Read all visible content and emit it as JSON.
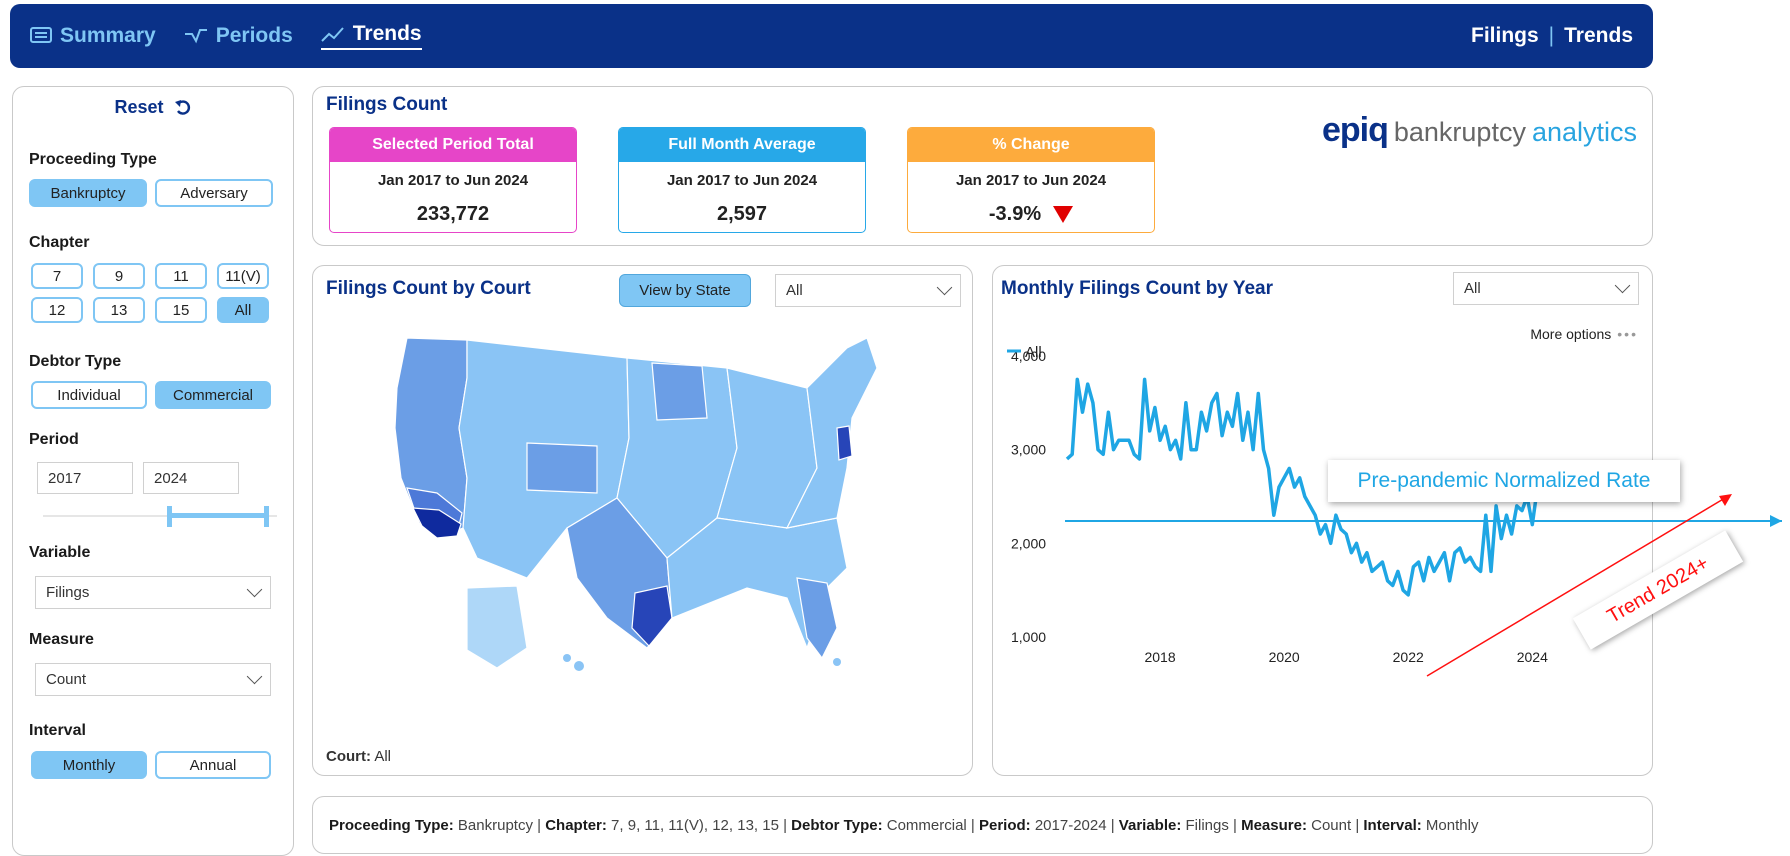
{
  "nav": {
    "tabs": [
      {
        "label": "Summary",
        "icon": "summary-icon"
      },
      {
        "label": "Periods",
        "icon": "periods-icon"
      },
      {
        "label": "Trends",
        "icon": "trends-icon"
      }
    ],
    "right_left": "Filings",
    "right_sep": "|",
    "right_right": "Trends"
  },
  "filters": {
    "reset_label": "Reset",
    "proceeding_type": {
      "label": "Proceeding Type",
      "options": [
        "Bankruptcy",
        "Adversary"
      ],
      "selected": "Bankruptcy"
    },
    "chapter": {
      "label": "Chapter",
      "options": [
        "7",
        "9",
        "11",
        "11(V)",
        "12",
        "13",
        "15",
        "All"
      ],
      "selected": "All"
    },
    "debtor_type": {
      "label": "Debtor Type",
      "options": [
        "Individual",
        "Commercial"
      ],
      "selected": "Commercial"
    },
    "period": {
      "label": "Period",
      "start": "2017",
      "end": "2024"
    },
    "variable": {
      "label": "Variable",
      "value": "Filings"
    },
    "measure": {
      "label": "Measure",
      "value": "Count"
    },
    "interval": {
      "label": "Interval",
      "options": [
        "Monthly",
        "Annual"
      ],
      "selected": "Monthly"
    }
  },
  "kpi": {
    "title": "Filings Count",
    "cards": [
      {
        "header": "Selected Period Total",
        "period": "Jan 2017 to Jun 2024",
        "value": "233,772",
        "color": "#e645c8"
      },
      {
        "header": "Full Month Average",
        "period": "Jan 2017 to Jun 2024",
        "value": "2,597",
        "color": "#27a8e8"
      },
      {
        "header": "% Change",
        "period": "Jan 2017 to Jun 2024",
        "value": "-3.9%",
        "color": "#fdab3d"
      }
    ],
    "logo_epiq": "epiq",
    "logo_text1": "bankruptcy",
    "logo_text2": "analytics"
  },
  "map": {
    "title": "Filings Count by Court",
    "view_button": "View by State",
    "dropdown_value": "All",
    "footer_label": "Court:",
    "footer_value": "All"
  },
  "trend": {
    "title": "Monthly Filings Count by Year",
    "dropdown_value": "All",
    "more_options": "More options",
    "annotation_rate": "Pre-pandemic Normalized Rate",
    "annotation_trend": "Trend 2024+"
  },
  "footer": {
    "parts": [
      {
        "label": "Proceeding Type:",
        "value": "Bankruptcy"
      },
      {
        "label": "Chapter:",
        "value": "7, 9, 11, 11(V), 12, 13, 15"
      },
      {
        "label": "Debtor Type:",
        "value": "Commercial"
      },
      {
        "label": "Period:",
        "value": "2017-2024"
      },
      {
        "label": "Variable:",
        "value": "Filings"
      },
      {
        "label": "Measure:",
        "value": "Count"
      },
      {
        "label": "Interval:",
        "value": "Monthly"
      }
    ]
  },
  "chart_data": {
    "type": "line",
    "title": "Monthly Filings Count by Year",
    "legend": [
      "All"
    ],
    "legend_position": "top-left",
    "x_ticks": [
      "2018",
      "2020",
      "2022",
      "2024"
    ],
    "y_ticks": [
      "1,000",
      "2,000",
      "3,000",
      "4,000"
    ],
    "ylim": [
      1000,
      4000
    ],
    "grid": false,
    "series": [
      {
        "name": "All",
        "color": "#1fa6e4",
        "x_start": "2017-01",
        "interval": "monthly",
        "values": [
          2900,
          2950,
          3750,
          3400,
          3700,
          3500,
          3000,
          2950,
          3400,
          3000,
          3100,
          3100,
          3100,
          2950,
          2900,
          3750,
          3200,
          3450,
          3100,
          3250,
          3000,
          3100,
          2900,
          3500,
          3000,
          3000,
          3400,
          3200,
          3500,
          3600,
          3150,
          3400,
          3250,
          3600,
          3100,
          3400,
          3000,
          3600,
          3000,
          2800,
          2300,
          2600,
          2700,
          2800,
          2600,
          2700,
          2500,
          2400,
          2300,
          2100,
          2200,
          2000,
          2300,
          2150,
          2100,
          1900,
          2000,
          1800,
          1900,
          1700,
          1750,
          1800,
          1600,
          1550,
          1700,
          1500,
          1450,
          1750,
          1800,
          1600,
          1850,
          1700,
          1800,
          1900,
          1600,
          1900,
          1950,
          1800,
          1850,
          1750,
          1700,
          2300,
          1700,
          2400,
          2050,
          2300,
          2100,
          2400,
          2350,
          2500,
          2200,
          2600,
          2500,
          2650,
          2750
        ]
      }
    ]
  }
}
